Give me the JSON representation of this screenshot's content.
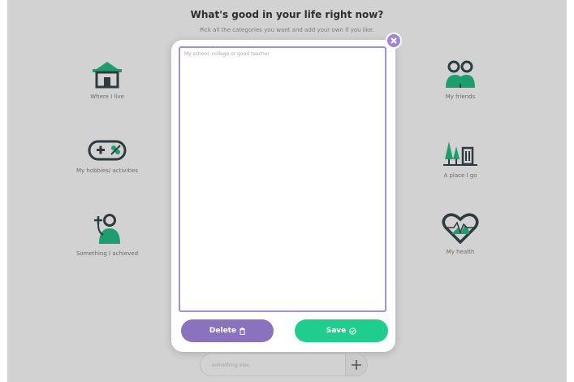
{
  "header": {
    "title": "What's good in your life right now?",
    "subtitle": "Pick all the categories you want and add your own if you like."
  },
  "categories_left": [
    {
      "label": "Where I live",
      "icon": "house-icon"
    },
    {
      "label": "My hobbies/ activities",
      "icon": "gamepad-icon"
    },
    {
      "label": "Something I achieved",
      "icon": "person-plus-icon"
    }
  ],
  "categories_right": [
    {
      "label": "My friends",
      "icon": "friends-icon"
    },
    {
      "label": "A place I go",
      "icon": "place-icon"
    },
    {
      "label": "My health",
      "icon": "heart-health-icon"
    }
  ],
  "modal": {
    "textarea_placeholder": "My school, college or good teacher",
    "delete_label": "Delete",
    "save_label": "Save"
  },
  "add_input": {
    "placeholder": "something else"
  },
  "colors": {
    "background": "#d2d2d2",
    "icon_green": "#1e9e6e",
    "icon_dark": "#2d3b3f",
    "purple": "#8b72bf",
    "green": "#1fce8c"
  }
}
